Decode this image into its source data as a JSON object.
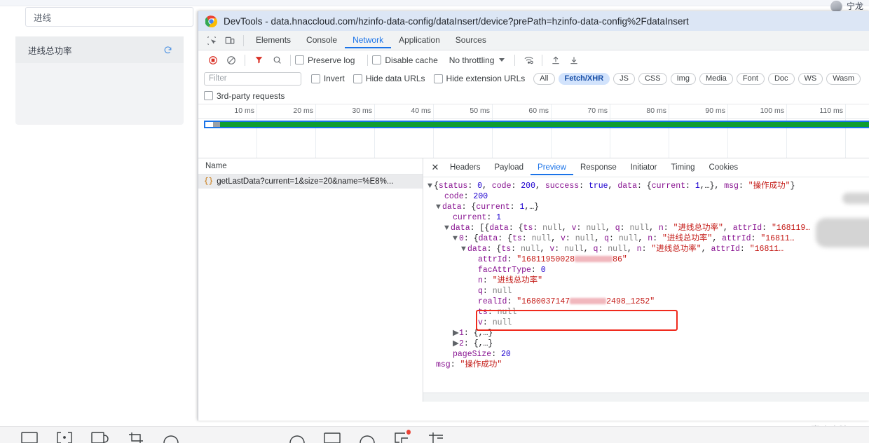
{
  "background_page": {
    "user_name": "宁龙",
    "search_value": "进线",
    "card_item_label": "进线总功率",
    "refresh_icon": "refresh-icon",
    "avatar_icon": "avatar-icon"
  },
  "devtools": {
    "title": "DevTools - data.hnaccloud.com/hzinfo-data-config/dataInsert/device?prePath=hzinfo-data-config%2FdataInsert",
    "logo_icon": "chrome-logo-icon",
    "toolbar_icons": {
      "inspect": "inspect-element-icon",
      "device": "device-toolbar-icon"
    },
    "panels": [
      {
        "label": "Elements",
        "selected": false
      },
      {
        "label": "Console",
        "selected": false
      },
      {
        "label": "Network",
        "selected": true
      },
      {
        "label": "Application",
        "selected": false
      },
      {
        "label": "Sources",
        "selected": false
      }
    ],
    "network_toolbar": {
      "record_icon": "record-stop-icon",
      "clear_icon": "clear-network-icon",
      "filter_icon": "filter-funnel-icon",
      "search_icon": "search-icon",
      "preserve_log_label": "Preserve log",
      "preserve_log_checked": false,
      "disable_cache_label": "Disable cache",
      "disable_cache_checked": false,
      "throttling_value": "No throttling",
      "throttling_caret_icon": "chevron-down-icon",
      "network_conditions_icon": "network-conditions-icon",
      "import_har_icon": "import-har-icon",
      "export_har_icon": "export-har-icon"
    },
    "filter_row": {
      "filter_placeholder": "Filter",
      "filter_value": "",
      "invert_label": "Invert",
      "invert_checked": false,
      "hide_data_urls_label": "Hide data URLs",
      "hide_data_urls_checked": false,
      "hide_extension_urls_label": "Hide extension URLs",
      "hide_extension_urls_checked": false,
      "type_filters": [
        {
          "label": "All",
          "active": false
        },
        {
          "label": "Fetch/XHR",
          "active": true
        },
        {
          "label": "JS",
          "active": false
        },
        {
          "label": "CSS",
          "active": false
        },
        {
          "label": "Img",
          "active": false
        },
        {
          "label": "Media",
          "active": false
        },
        {
          "label": "Font",
          "active": false
        },
        {
          "label": "Doc",
          "active": false
        },
        {
          "label": "WS",
          "active": false
        },
        {
          "label": "Wasm",
          "active": false
        }
      ]
    },
    "third_party_row": {
      "label": "3rd-party requests",
      "checked": false
    },
    "timeline": {
      "ticks": [
        "10 ms",
        "20 ms",
        "30 ms",
        "40 ms",
        "50 ms",
        "60 ms",
        "70 ms",
        "80 ms",
        "90 ms",
        "100 ms",
        "110 ms"
      ],
      "bar_color": "#0f9d2f",
      "selection_color": "#1a73e8"
    },
    "request_list": {
      "column_header": "Name",
      "sort_caret_icon": "chevron-down-icon",
      "rows": [
        {
          "icon": "xhr-braces-icon",
          "name": "getLastData?current=1&size=20&name=%E8%...",
          "selected": true
        }
      ]
    },
    "detail_tabs": {
      "close_icon": "close-icon",
      "tabs": [
        {
          "label": "Headers",
          "selected": false
        },
        {
          "label": "Payload",
          "selected": false
        },
        {
          "label": "Preview",
          "selected": true
        },
        {
          "label": "Response",
          "selected": false
        },
        {
          "label": "Initiator",
          "selected": false
        },
        {
          "label": "Timing",
          "selected": false
        },
        {
          "label": "Cookies",
          "selected": false
        }
      ]
    },
    "preview_json": {
      "lines": [
        {
          "indent": 0,
          "arrow": "open",
          "text": "{status: 0, code: 200, success: true, data: {current: 1,…}, msg: \"操作成功\"}"
        },
        {
          "indent": 1,
          "arrow": "none",
          "text": "code: 200"
        },
        {
          "indent": 1,
          "arrow": "open",
          "text": "data: {current: 1,…}"
        },
        {
          "indent": 2,
          "arrow": "none",
          "text": "current: 1"
        },
        {
          "indent": 2,
          "arrow": "open",
          "text": "data: [{data: {ts: null, v: null, q: null, n: \"进线总功率\", attrId: \"168119…"
        },
        {
          "indent": 3,
          "arrow": "open",
          "text": "0: {data: {ts: null, v: null, q: null, n: \"进线总功率\", attrId: \"16811…"
        },
        {
          "indent": 4,
          "arrow": "open",
          "text": "data: {ts: null, v: null, q: null, n: \"进线总功率\", attrId: \"16811…"
        },
        {
          "indent": 5,
          "arrow": "none",
          "text": "attrId: \"16811950020000086\""
        },
        {
          "indent": 5,
          "arrow": "none",
          "text": "facAttrType: 0"
        },
        {
          "indent": 5,
          "arrow": "none",
          "text": "n: \"进线总功率\""
        },
        {
          "indent": 5,
          "arrow": "none",
          "text": "q: null"
        },
        {
          "indent": 5,
          "arrow": "none",
          "text": "realId: \"16800371470002498_1252\""
        },
        {
          "indent": 5,
          "arrow": "none",
          "text": "ts: null"
        },
        {
          "indent": 5,
          "arrow": "none",
          "text": "v: null"
        },
        {
          "indent": 3,
          "arrow": "closed",
          "text": "1: {,…}"
        },
        {
          "indent": 3,
          "arrow": "closed",
          "text": "2: {,…}"
        },
        {
          "indent": 2,
          "arrow": "none",
          "text": "pageSize: 20"
        },
        {
          "indent": 1,
          "arrow": "none",
          "text": "msg: \"操作成功\""
        }
      ],
      "highlighted_line_key": "realId",
      "highlight_color": "#f02a1d",
      "redacted_values": [
        "attrId",
        "realId"
      ]
    }
  },
  "watermark": "CSDN @喜欢吃糖丶",
  "taskbar": {
    "items": [
      {
        "icon": "window-icon"
      },
      {
        "icon": "brackets-icon"
      },
      {
        "icon": "monitor-icon"
      },
      {
        "icon": "crop-icon"
      },
      {
        "icon": "cloud-icon"
      },
      {
        "icon": "cloud2-icon"
      },
      {
        "icon": "window2-icon"
      },
      {
        "icon": "cloud3-icon"
      },
      {
        "icon": "chat-icon",
        "badge": true
      },
      {
        "icon": "sum-icon"
      }
    ]
  }
}
